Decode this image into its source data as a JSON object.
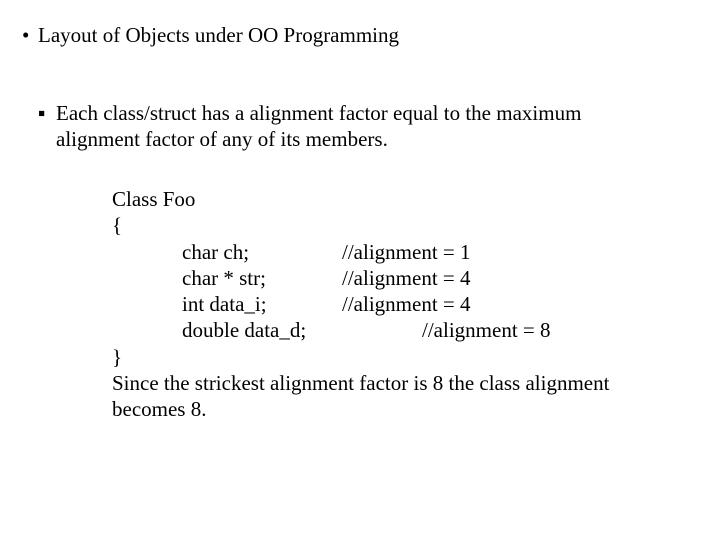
{
  "main_bullet": "Layout of Objects under OO Programming",
  "sub_bullet": "Each class/struct has a alignment factor equal to the maximum alignment factor of any of its members.",
  "code": {
    "line1": "Class Foo",
    "line2": "{",
    "members": [
      {
        "decl": "char ch;",
        "comment": "//alignment = 1",
        "wide": false
      },
      {
        "decl": "char * str;",
        "comment": "//alignment = 4",
        "wide": false
      },
      {
        "decl": "int data_i;",
        "comment": "//alignment = 4",
        "wide": false
      },
      {
        "decl": "double data_d;",
        "comment": "//alignment = 8",
        "wide": true
      }
    ],
    "line_close": "}",
    "note": "Since the strickest alignment factor is 8 the class alignment becomes 8."
  },
  "glyphs": {
    "dot": "•",
    "square": "▪"
  }
}
